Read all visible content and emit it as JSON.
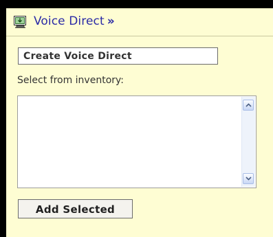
{
  "header": {
    "title": "Voice Direct",
    "chevron": "»",
    "icon": "monitor-download-icon",
    "title_color": "#2a2aa6"
  },
  "create_button": {
    "label": "Create Voice Direct"
  },
  "inventory": {
    "label": "Select from inventory:",
    "items": []
  },
  "add_button": {
    "label": "Add Selected"
  },
  "colors": {
    "panel_background": "#fefdd3",
    "frame": "#000000"
  }
}
